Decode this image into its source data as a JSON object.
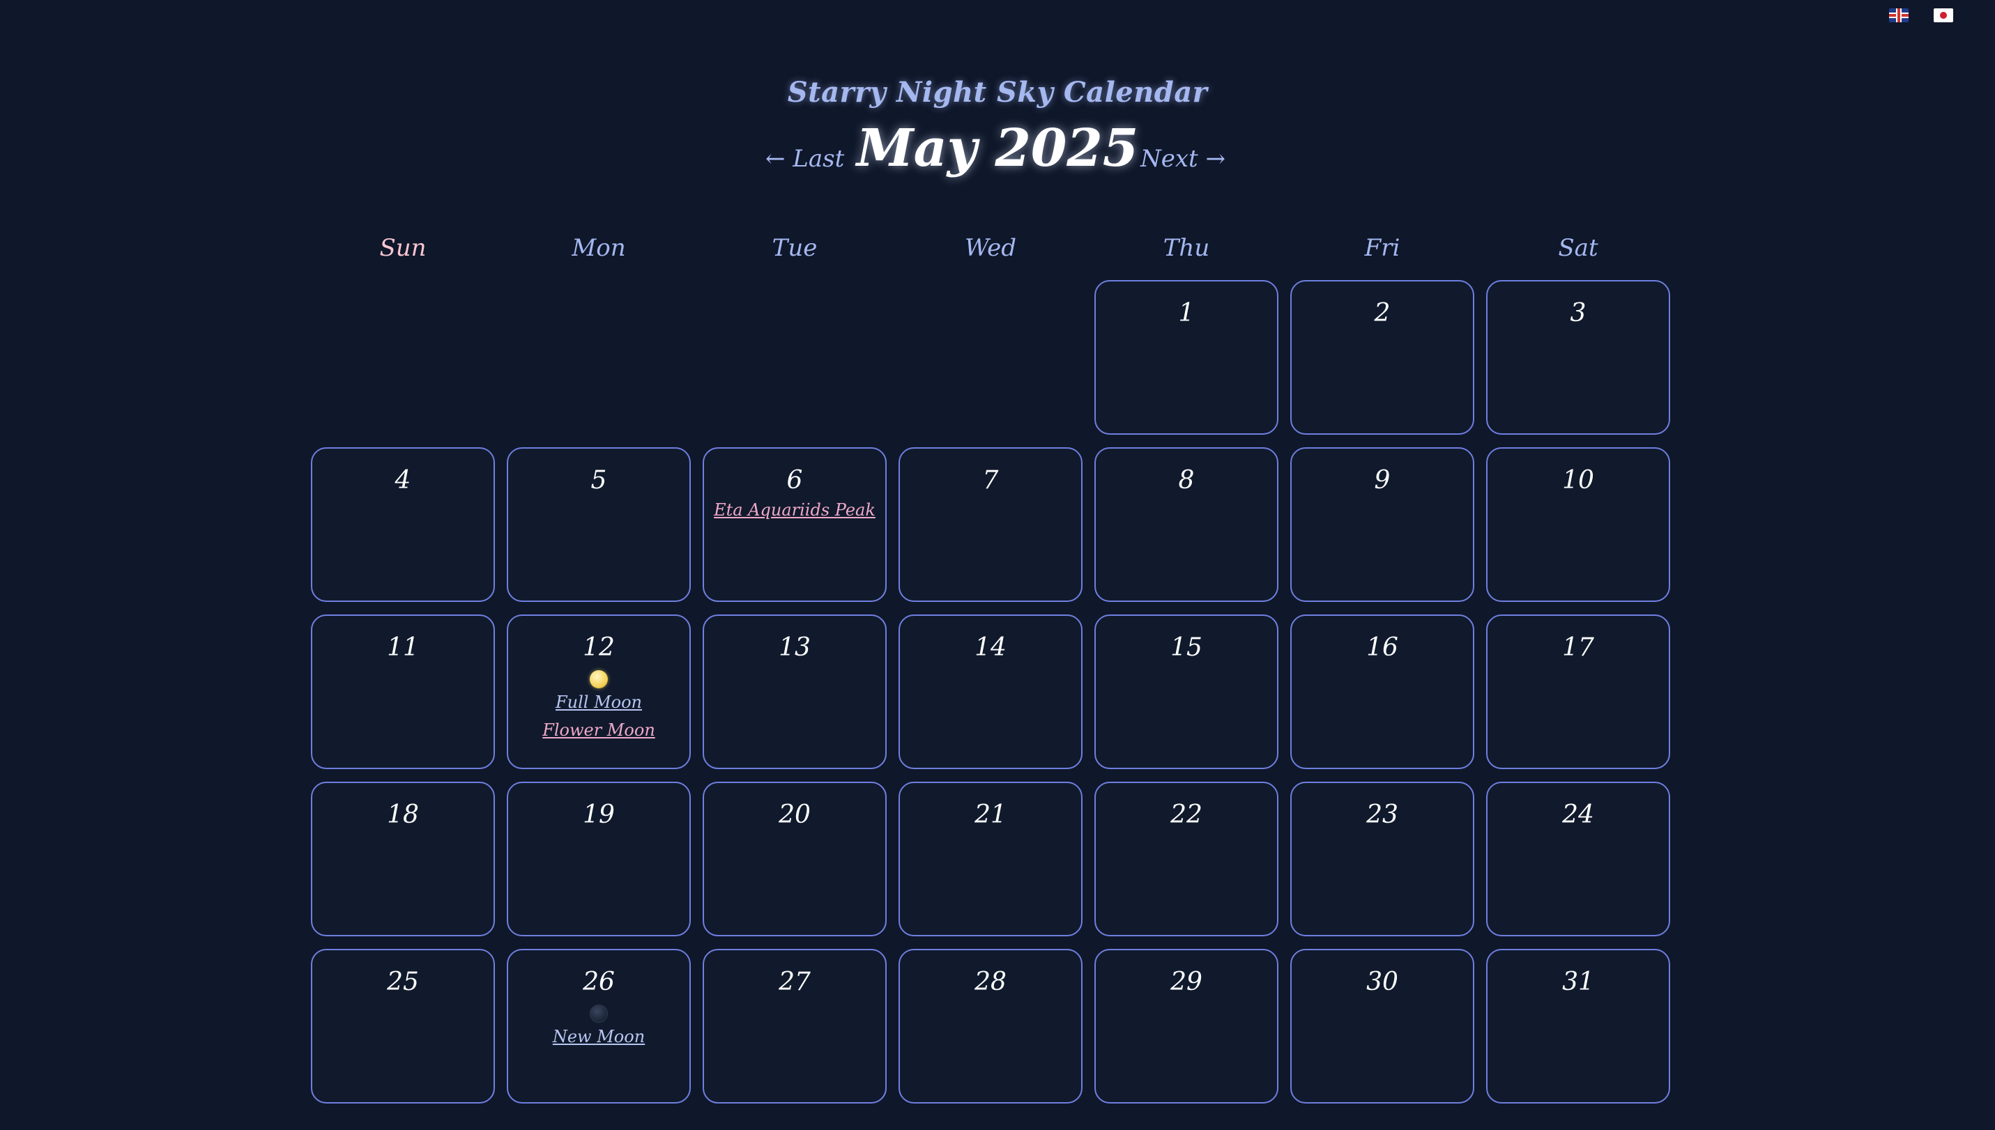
{
  "languages": [
    {
      "name": "english-flag-icon",
      "label": "English"
    },
    {
      "name": "japanese-flag-icon",
      "label": "Japanese"
    }
  ],
  "app_title": "Starry Night Sky Calendar",
  "nav": {
    "prev_label": "← Last",
    "next_label": "Next →",
    "month_title": "May 2025"
  },
  "weekdays": [
    "Sun",
    "Mon",
    "Tue",
    "Wed",
    "Thu",
    "Fri",
    "Sat"
  ],
  "leading_empty_days": 4,
  "days": [
    {
      "day": "1"
    },
    {
      "day": "2"
    },
    {
      "day": "3"
    },
    {
      "day": "4"
    },
    {
      "day": "5"
    },
    {
      "day": "6",
      "events": [
        {
          "label": "Eta Aquariids Peak",
          "kind": "festival"
        }
      ]
    },
    {
      "day": "7"
    },
    {
      "day": "8"
    },
    {
      "day": "9"
    },
    {
      "day": "10"
    },
    {
      "day": "11"
    },
    {
      "day": "12",
      "moon": "full-moon-icon",
      "events": [
        {
          "label": "Full Moon",
          "kind": "moon"
        },
        {
          "label": "Flower Moon",
          "kind": "festival"
        }
      ]
    },
    {
      "day": "13"
    },
    {
      "day": "14"
    },
    {
      "day": "15"
    },
    {
      "day": "16"
    },
    {
      "day": "17"
    },
    {
      "day": "18"
    },
    {
      "day": "19"
    },
    {
      "day": "20"
    },
    {
      "day": "21"
    },
    {
      "day": "22"
    },
    {
      "day": "23"
    },
    {
      "day": "24"
    },
    {
      "day": "25"
    },
    {
      "day": "26",
      "moon": "new-moon-icon",
      "events": [
        {
          "label": "New Moon",
          "kind": "moon"
        }
      ]
    },
    {
      "day": "27"
    },
    {
      "day": "28"
    },
    {
      "day": "29"
    },
    {
      "day": "30"
    },
    {
      "day": "31"
    }
  ],
  "colors": {
    "background": "#0f172a",
    "cell_border": "#6f7fe0",
    "accent": "#a5b8f0",
    "sunday": "#f9c5d1",
    "moon_event": "#b8c6f2",
    "festival_event": "#f0a8c8"
  }
}
